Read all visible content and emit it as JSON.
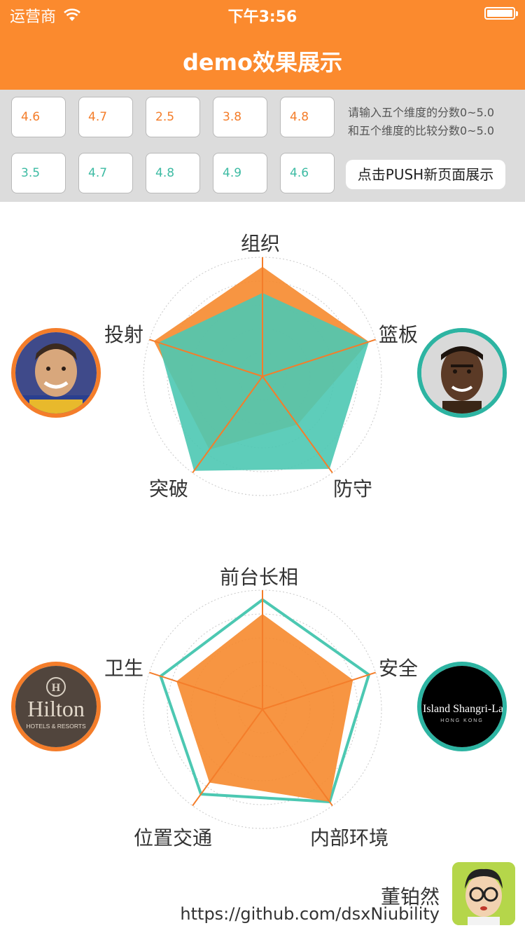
{
  "status_bar": {
    "carrier": "运营商",
    "time": "下午3:56"
  },
  "nav": {
    "title": "demo效果展示"
  },
  "inputs": {
    "row1": [
      "4.6",
      "4.7",
      "2.5",
      "3.8",
      "4.8"
    ],
    "row2": [
      "3.5",
      "4.7",
      "4.8",
      "4.9",
      "4.6"
    ],
    "hint_line1": "请输入五个维度的分数0~5.0",
    "hint_line2": "和五个维度的比较分数0~5.0",
    "push_label": "点击PUSH新页面展示"
  },
  "chart_data": [
    {
      "type": "radar",
      "axes": [
        "组织",
        "篮板",
        "防守",
        "突破",
        "投射"
      ],
      "max": 5.0,
      "series": [
        {
          "values": [
            4.6,
            4.7,
            2.5,
            3.8,
            4.8
          ],
          "color": "#f68a2e",
          "style": "filled"
        },
        {
          "values": [
            3.5,
            4.7,
            4.8,
            4.9,
            4.6
          ],
          "color": "#4cc8b2",
          "style": "filled"
        }
      ],
      "left_avatar": {
        "description": "basketball player",
        "ring_color": "#f47d2a"
      },
      "right_avatar": {
        "description": "basketball player",
        "ring_color": "#2db4a2"
      }
    },
    {
      "type": "radar",
      "axes": [
        "前台长相",
        "安全",
        "内部环境",
        "位置交通",
        "卫生"
      ],
      "max": 5.0,
      "series": [
        {
          "values": [
            4.6,
            4.7,
            4.8,
            4.4,
            4.5
          ],
          "color": "#4cc8b2",
          "style": "outline"
        },
        {
          "values": [
            4.0,
            4.0,
            4.8,
            3.8,
            3.8
          ],
          "color": "#f68a2e",
          "style": "filled"
        }
      ],
      "left_logo": {
        "text": "Hilton",
        "subtext": "HOTELS & RESORTS",
        "ring_color": "#f47d2a"
      },
      "right_logo": {
        "text": "Island Shangri-La",
        "subtext": "HONG KONG",
        "ring_color": "#2db4a2"
      }
    }
  ],
  "credits": {
    "name": "董铂然",
    "url": "https://github.com/dsxNiubility"
  }
}
